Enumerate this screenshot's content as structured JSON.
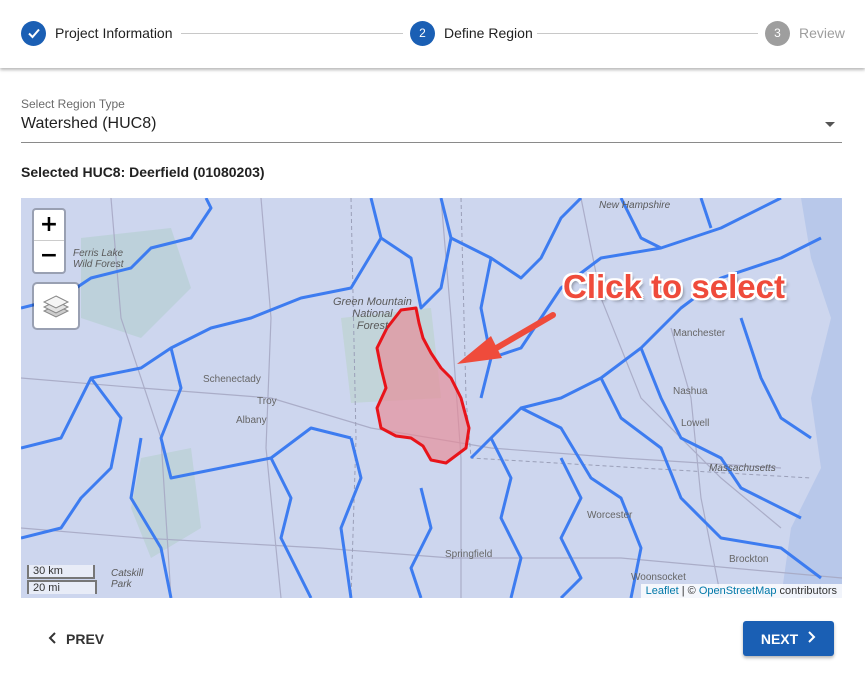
{
  "stepper": {
    "steps": [
      {
        "number": "",
        "label": "Project Information",
        "state": "done"
      },
      {
        "number": "2",
        "label": "Define Region",
        "state": "active"
      },
      {
        "number": "3",
        "label": "Review",
        "state": "pending"
      }
    ],
    "done_icon": "check-icon"
  },
  "region_select": {
    "label": "Select Region Type",
    "value": "Watershed (HUC8)",
    "icon": "dropdown-arrow-icon"
  },
  "selected_huc": "Selected HUC8: Deerfield (01080203)",
  "map": {
    "zoom_in": "+",
    "zoom_out": "−",
    "layers_icon": "layers-icon",
    "scale_km": "30 km",
    "scale_mi": "20 mi",
    "attribution": {
      "leaflet": "Leaflet",
      "sep": " | © ",
      "osm": "OpenStreetMap",
      "suffix": " contributors"
    },
    "callout": "Click to select",
    "place_labels": {
      "ferris_lake": "Ferris Lake\nWild Forest",
      "green_mountain": "Green Mountain\nNational\nForest",
      "new_hampshire": "New Hampshire",
      "manchester": "Manchester",
      "schenectady": "Schenectady",
      "troy": "Troy",
      "albany": "Albany",
      "nashua": "Nashua",
      "lowell": "Lowell",
      "massachusetts": "Massachusetts",
      "worcester": "Worcester",
      "springfield": "Springfield",
      "brockton": "Brockton",
      "woonsocket": "Woonsocket",
      "catskill": "Catskill\nPark"
    },
    "colors": {
      "watershed_boundary": "#3d7cf0",
      "selected_fill": "#e88b95",
      "selected_stroke": "#e8141a",
      "callout": "#ef4b3b"
    }
  },
  "nav": {
    "prev_label": "PREV",
    "next_label": "NEXT",
    "prev_icon": "chevron-left-icon",
    "next_icon": "chevron-right-icon",
    "accent": "#1a5fb4"
  }
}
